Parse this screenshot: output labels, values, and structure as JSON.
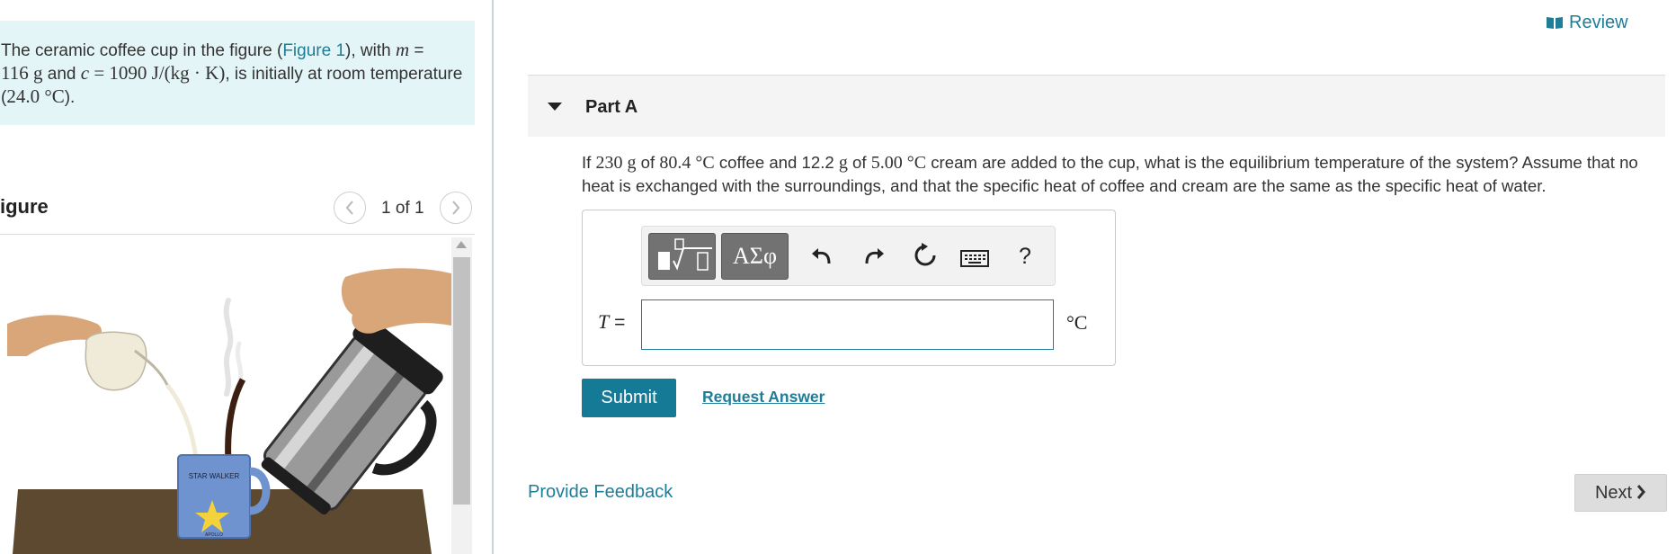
{
  "problem": {
    "text_start": "The ceramic coffee cup in the figure (",
    "figure_link": "Figure 1",
    "text_after_link": "), with ",
    "var_m": "m",
    "eq": " = ",
    "m_value": "116 g",
    "and_text": " and ",
    "var_c": "c",
    "c_eq": " = ",
    "c_value": "1090 J/(kg · K)",
    "text_mid": ", is initially at room temperature (",
    "room_temp": "24.0 °C",
    "text_end": ")."
  },
  "figure": {
    "title": "igure",
    "pager": "1 of 1",
    "prev_icon": "chevron-left-icon",
    "next_icon": "chevron-right-icon",
    "mug_text": "STAR WALKER",
    "mug_bottom_text": "APOLLO",
    "colors": {
      "table": "#5d4930",
      "mug": "#6f93cf",
      "cream": "#f0ead8",
      "coffee": "#3a1f12",
      "steel": "#8a8a8a"
    }
  },
  "header": {
    "review_label": "Review",
    "review_icon": "book-icon"
  },
  "part": {
    "title": "Part A",
    "question_1": "If ",
    "coffee_mass": "230 g",
    "question_2": " of ",
    "coffee_temp": "80.4 °C",
    "question_3": " coffee and 12.2 ",
    "unit_g": "g",
    "question_4": " of ",
    "cream_temp": "5.00 °C",
    "question_5": " cream are added to the cup, what is the equilibrium temperature of the system? Assume that no heat is exchanged with the surroundings, and that the specific heat of coffee and cream are the same as the specific heat of water."
  },
  "answer": {
    "toolbar": {
      "symbols_label": "ΑΣφ",
      "help_label": "?"
    },
    "variable": "T",
    "equals": " =",
    "value": "",
    "unit": "°C"
  },
  "actions": {
    "submit_label": "Submit",
    "request_label": "Request Answer",
    "feedback_label": "Provide Feedback",
    "next_label": "Next"
  },
  "colors": {
    "accent": "#1f7d97",
    "submit_bg": "#157a96",
    "problem_bg": "#e4f5f7"
  }
}
